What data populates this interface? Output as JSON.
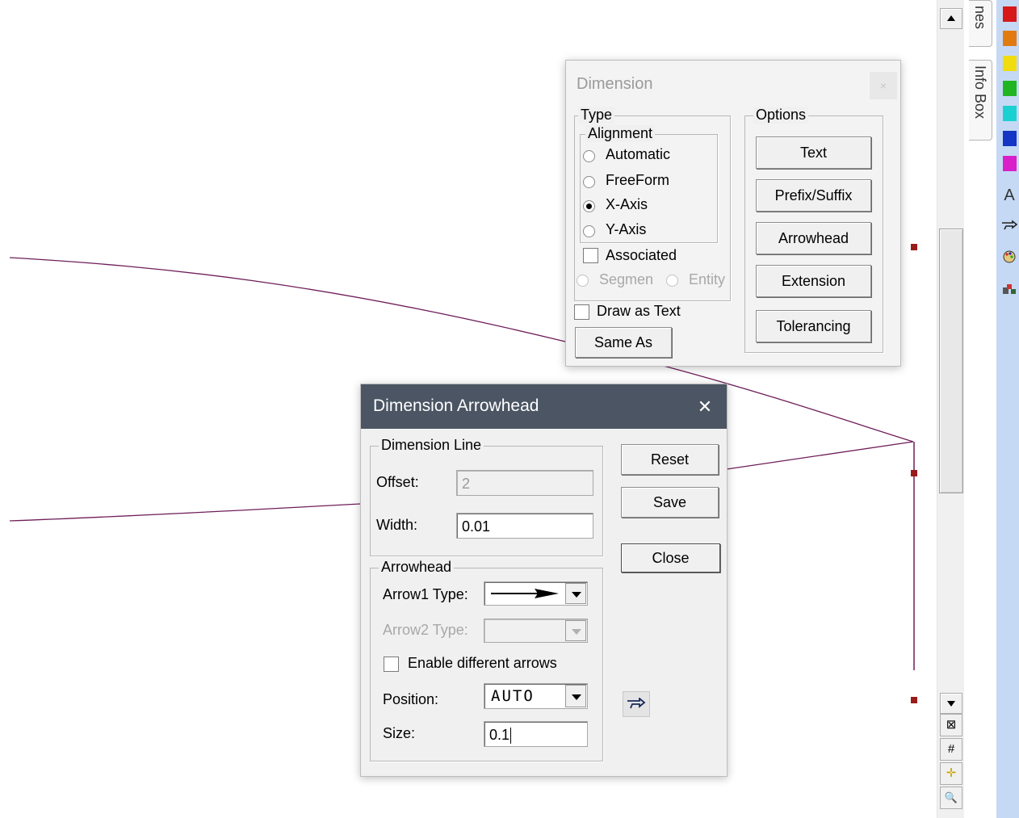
{
  "main_dialog": {
    "title": "Dimension",
    "close_label": "×",
    "type_group": "Type",
    "alignment_group": "Alignment",
    "alignment_options": [
      "Automatic",
      "FreeForm",
      "X-Axis",
      "Y-Axis"
    ],
    "alignment_selected": "X-Axis",
    "associated_label": "Associated",
    "segment_label": "Segmen",
    "entity_label": "Entity",
    "draw_as_text_label": "Draw as Text",
    "same_as_label": "Same As",
    "options_group": "Options",
    "option_buttons": [
      "Text",
      "Prefix/Suffix",
      "Arrowhead",
      "Extension",
      "Tolerancing"
    ]
  },
  "arrowhead_dialog": {
    "title": "Dimension Arrowhead",
    "close_label": "✕",
    "dimension_line_group": "Dimension Line",
    "offset_label": "Offset:",
    "offset_value": "2",
    "width_label": "Width:",
    "width_value": "0.01",
    "arrowhead_group": "Arrowhead",
    "arrow1_label": "Arrow1 Type:",
    "arrow2_label": "Arrow2 Type:",
    "enable_diff_label": "Enable different arrows",
    "position_label": "Position:",
    "position_value": "AUTO",
    "size_label": "Size:",
    "size_value": "0.1",
    "reset_label": "Reset",
    "save_label": "Save",
    "close_button_label": "Close"
  },
  "side_tabs": {
    "tab1": "nes",
    "tab2": "Info Box"
  },
  "palette": {
    "colors": [
      "#d71919",
      "#e27a12",
      "#f1dc10",
      "#22b522",
      "#1bd0d0",
      "#1536c4",
      "#d81fc9"
    ],
    "icons": [
      "text-a-icon",
      "pointer-hand-icon",
      "palette-icon",
      "layers-icon"
    ],
    "text_icon": "A"
  },
  "scrollbar_tools": [
    "zoom-box-icon",
    "grid-icon",
    "snap-cross-icon",
    "zoom-icon"
  ],
  "tool_glyphs": [
    "⊠",
    "#",
    "✛",
    "🔍"
  ]
}
